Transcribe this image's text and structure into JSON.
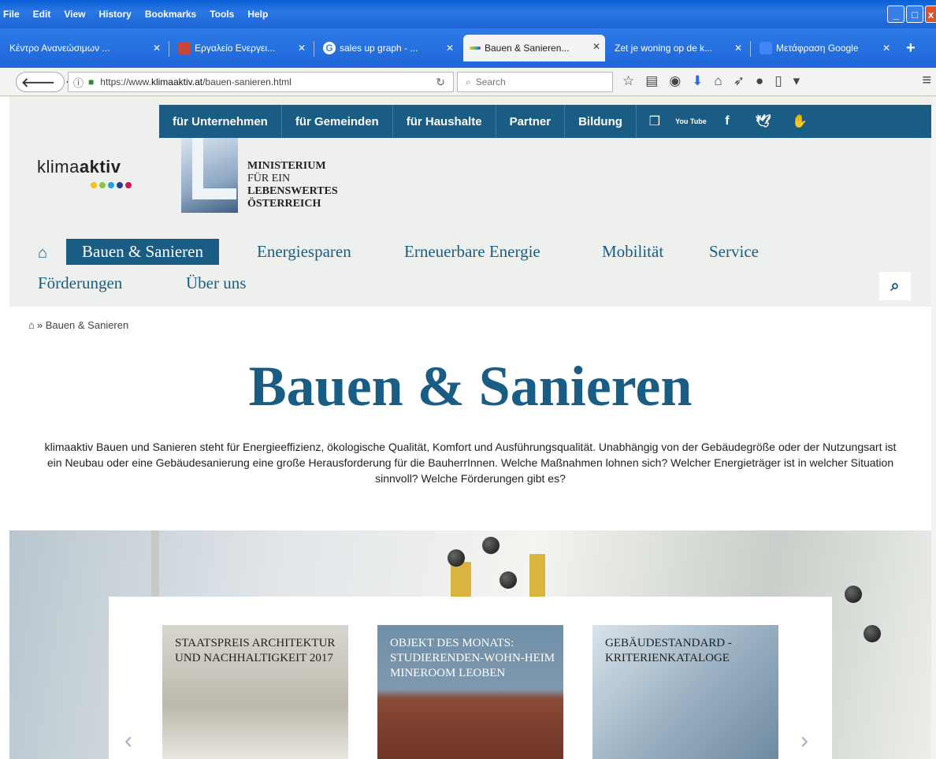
{
  "browser": {
    "menu": [
      "File",
      "Edit",
      "View",
      "History",
      "Bookmarks",
      "Tools",
      "Help"
    ],
    "tabs": [
      {
        "label": "Κέντρο Ανανεώσιμων ..."
      },
      {
        "label": "Εργαλείο Ενεργει..."
      },
      {
        "label": "sales up graph - ..."
      },
      {
        "label": "Bauen & Sanieren..."
      },
      {
        "label": "Zet je woning op de k..."
      },
      {
        "label": "Μετάφραση Google"
      }
    ],
    "url_prefix": "https://www.",
    "url_host": "klimaaktiv.at",
    "url_path": "/bauen-sanieren.html",
    "search_placeholder": "Search"
  },
  "site": {
    "topnav": [
      "für Unternehmen",
      "für Gemeinden",
      "für Haushalte",
      "Partner",
      "Bildung"
    ],
    "social": {
      "youtube": "You Tube",
      "facebook": "f"
    },
    "logo_light": "klima",
    "logo_bold": "aktiv",
    "logo_dot_colors": [
      "#f2c313",
      "#8cc63f",
      "#1aa3dd",
      "#2b3c8f",
      "#d4145a"
    ],
    "ministry": [
      "MINISTERIUM",
      "FÜR EIN",
      "LEBENSWERTES",
      "ÖSTERREICH"
    ],
    "mainnav": [
      "Bauen & Sanieren",
      "Energiesparen",
      "Erneuerbare Energie",
      "Mobilität",
      "Service",
      "Förderungen",
      "Über uns"
    ],
    "breadcrumb": "» Bauen & Sanieren",
    "title": "Bauen & Sanieren",
    "intro": "klimaaktiv Bauen und Sanieren steht für Energieeffizienz, ökologische Qualität, Komfort und Ausführungsqualität. Unabhängig von der Gebäudegröße oder der Nutzungsart ist ein Neubau oder eine Gebäudesanierung eine große Herausforderung für die BauherrInnen. Welche Maßnahmen lohnen sich? Welcher Energieträger ist in welcher Situation sinnvoll? Welche Förderungen gibt es?",
    "cards": [
      {
        "title": "Staatspreis Architektur und Nachhaltigkeit 2017"
      },
      {
        "title": "Objekt des Monats: Studierenden-Wohn-heim Mineroom Leoben"
      },
      {
        "title": "Gebäudestandard - Kriterienkataloge"
      }
    ],
    "brand_color": "#1a5d84"
  }
}
